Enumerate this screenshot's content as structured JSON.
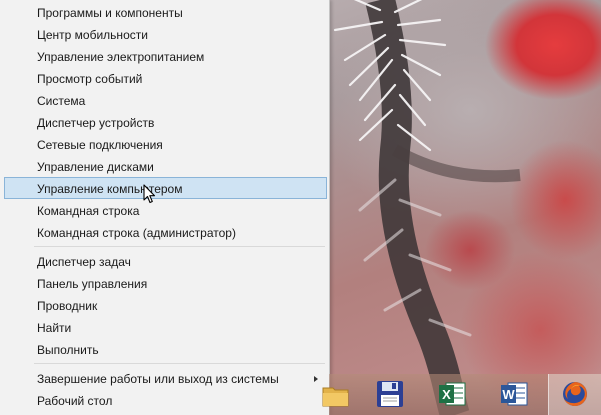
{
  "menu": {
    "groups": [
      [
        {
          "label": "Программы и компоненты"
        },
        {
          "label": "Центр мобильности"
        },
        {
          "label": "Управление электропитанием"
        },
        {
          "label": "Просмотр событий"
        },
        {
          "label": "Система"
        },
        {
          "label": "Диспетчер устройств"
        },
        {
          "label": "Сетевые подключения"
        },
        {
          "label": "Управление дисками"
        },
        {
          "label": "Управление компьютером",
          "selected": true
        },
        {
          "label": "Командная строка"
        },
        {
          "label": "Командная строка (администратор)"
        }
      ],
      [
        {
          "label": "Диспетчер задач"
        },
        {
          "label": "Панель управления"
        },
        {
          "label": "Проводник"
        },
        {
          "label": "Найти"
        },
        {
          "label": "Выполнить"
        }
      ],
      [
        {
          "label": "Завершение работы или выход из системы",
          "has_submenu": true
        },
        {
          "label": "Рабочий стол"
        }
      ]
    ],
    "colors": {
      "highlight": "#cfe3f3",
      "highlight_border": "#8ab4d8",
      "background": "#f2f2f2"
    }
  },
  "taskbar": {
    "icons": [
      {
        "name": "folder-icon"
      },
      {
        "name": "save-disk-icon"
      },
      {
        "name": "excel-icon",
        "letter": "X"
      },
      {
        "name": "word-icon",
        "letter": "W"
      },
      {
        "name": "firefox-icon",
        "active": true
      }
    ]
  }
}
